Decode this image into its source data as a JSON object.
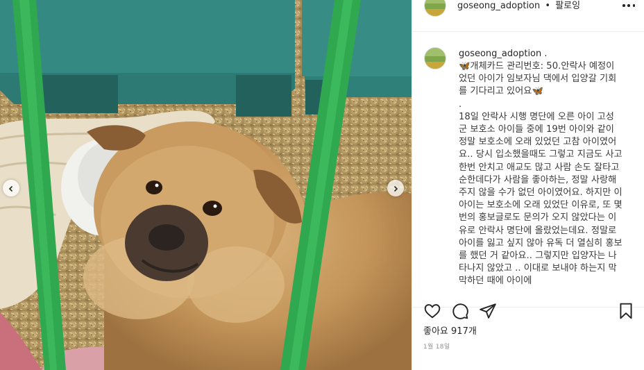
{
  "post": {
    "username": "goseong_adoption",
    "follow_separator": "•",
    "follow_label": "팔로잉",
    "caption_username": "goseong_adoption .",
    "caption_text": "🦋개체카드 관리번호: 50.안락사 예정이었던 아이가 임보자님 댁에서 입양갈 기회를 기다리고 있어요🦋\n.\n18일 안락사 시행 명단에 오른 아이 고성군 보호소 아이들 중에 19번 아이와 같이 정말 보호소에 오래 있었던 고참 아이였어요.. 당시 입소했을때도 그렇고 지금도 사고한번 안치고 애교도 많고 사람 손도 잘타고 순한데다가 사람을 좋아하는, 정말 사랑해주지 않을 수가 없던 아이였어요. 하지만 이 아이는 보호소에 오래 있었단 이유로, 또 몇번의 홍보글로도 문의가 오지 않았다는 이유로 안락사 명단에 올랐었는데요. 정말로 아이를 잃고 싶지 않아 유독 더 열심히 홍보를 했던 거 같아요.. 그렇지만 입양자는 나타나지 않았고 .. 이대로 보내야 하는지 막막하던 때에 아이에",
    "likes_label": "좋아요",
    "likes_count": "917개",
    "date": "1월 18일"
  },
  "icons": {
    "like": "heart-icon",
    "comment": "speech-bubble-icon",
    "share": "paper-plane-icon",
    "save": "bookmark-icon",
    "more": "more-horizontal-icon",
    "prev": "chevron-left-icon",
    "next": "chevron-right-icon"
  },
  "colors": {
    "text": "#262626",
    "secondary": "#8e8e8e",
    "border": "#efefef",
    "gate_green": "#2fa84f"
  }
}
